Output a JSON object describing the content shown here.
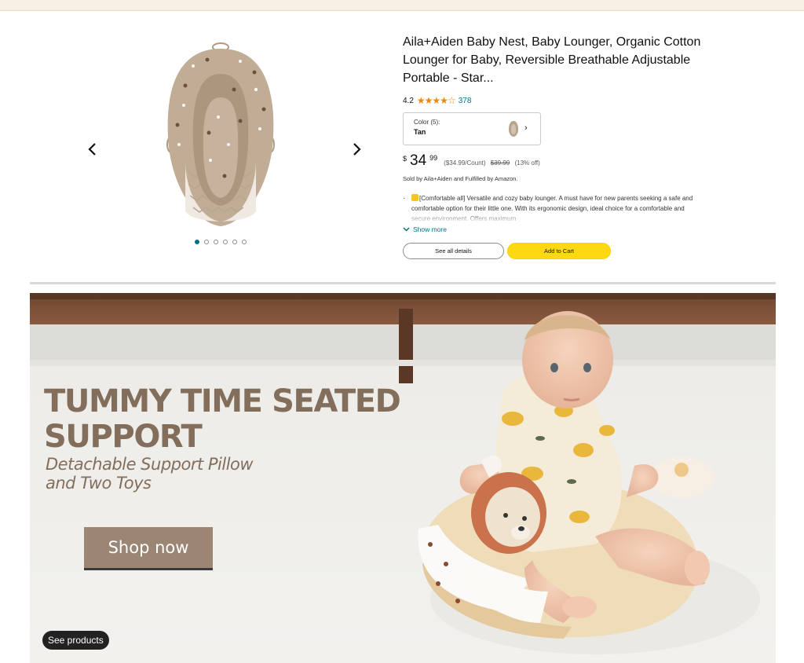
{
  "product": {
    "title": "Aila+Aiden Baby Nest, Baby Lounger, Organic Cotton Lounger for Baby, Reversible Breathable Adjustable Portable - Star...",
    "rating": "4.2",
    "stars_value": 4.2,
    "stars_glyphs": "★★★★☆",
    "review_count": "378",
    "color_label": "Color (5):",
    "color_value": "Tan",
    "price_symbol": "$",
    "price_whole": "34",
    "price_fraction": "99",
    "unit_price": "($34.99/Count)",
    "list_price": "$39.99",
    "discount": "(13% off)",
    "sold_by": "Sold by Aila+Aiden and Fulfilled by Amazon.",
    "bullet": "[Comfortable all] Versatile and cozy baby lounger. A must have for new parents seeking a safe and comfortable option for their little one. With its ergonomic design, ideal choice for a comfortable and secure environment. Offers maximum",
    "show_more": "Show more",
    "see_details": "See all details",
    "add_to_cart": "Add to Cart",
    "image_count": 6,
    "active_image": 1
  },
  "banner": {
    "headline_line1": "TUMMY TIME SEATED",
    "headline_line2": "SUPPORT",
    "sub_line1": "Detachable Support Pillow",
    "sub_line2": "and Two Toys",
    "shop_now": "Shop now",
    "see_products": "See products"
  },
  "colors": {
    "link": "#007185",
    "cart_button": "#ffd814",
    "star": "#f08804",
    "banner_text": "#836e5c",
    "shop_button": "#9b8573"
  },
  "icons": [
    "chevron-left-icon",
    "chevron-right-icon",
    "chevron-down-icon",
    "star-icon"
  ]
}
